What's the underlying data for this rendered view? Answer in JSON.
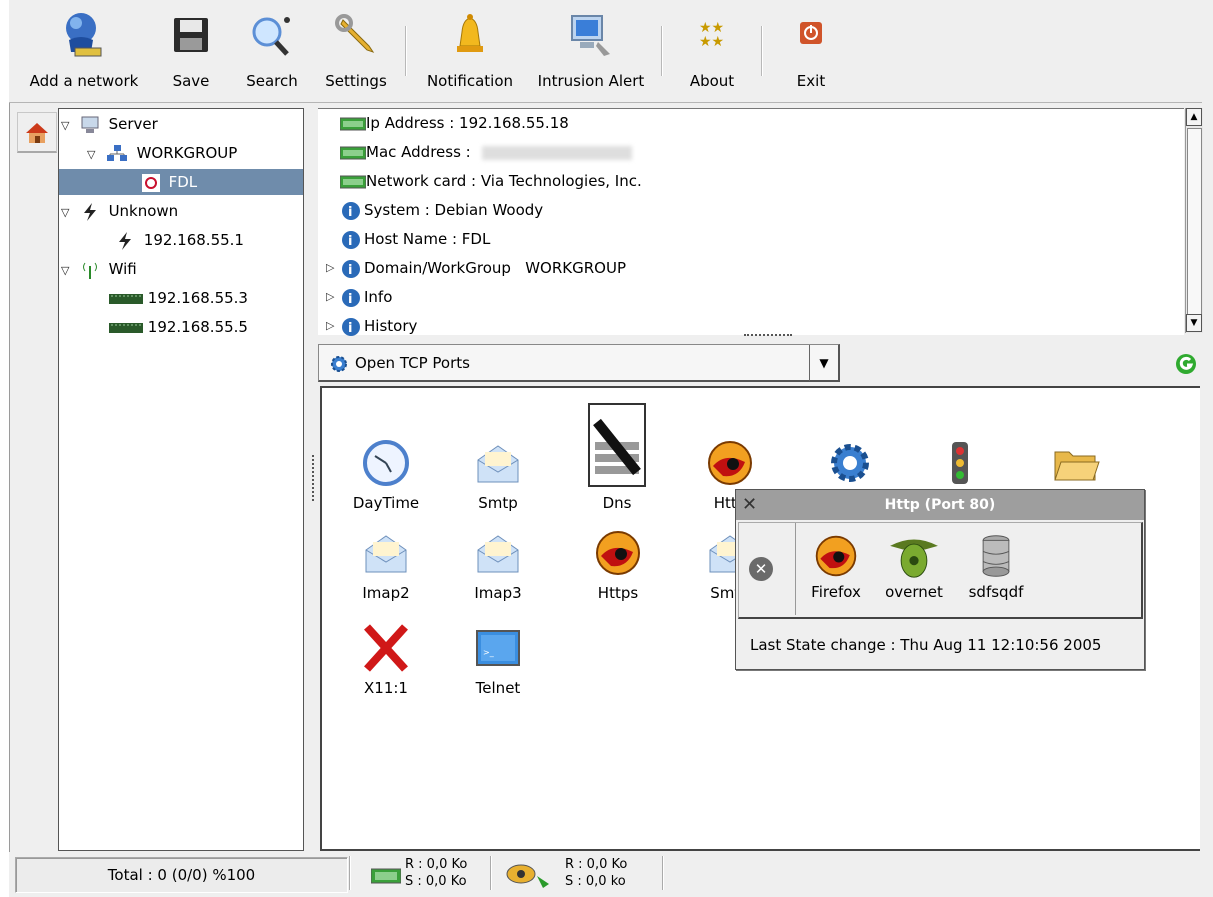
{
  "toolbar": {
    "items": [
      {
        "label": "Add a network",
        "icon": "network-globe-icon"
      },
      {
        "label": "Save",
        "icon": "floppy-disk-icon"
      },
      {
        "label": "Search",
        "icon": "magnifier-icon"
      },
      {
        "label": "Settings",
        "icon": "wrench-icon"
      },
      {
        "label": "Notification",
        "icon": "bell-icon"
      },
      {
        "label": "Intrusion Alert",
        "icon": "computer-alert-icon"
      },
      {
        "label": "About",
        "icon": "stars-icon"
      },
      {
        "label": "Exit",
        "icon": "power-icon"
      }
    ]
  },
  "tree": {
    "server": "Server",
    "workgroup": "WORKGROUP",
    "fdl": "FDL",
    "unknown": "Unknown",
    "unknown_host": "192.168.55.1",
    "wifi": "Wifi",
    "wifi_host1": "192.168.55.3",
    "wifi_host2": "192.168.55.5"
  },
  "info": {
    "ip": "Ip Address : 192.168.55.18",
    "mac": "Mac Address :",
    "netcard": "Network card : Via Technologies, Inc.",
    "system": "System : Debian Woody",
    "hostname": "Host Name : FDL",
    "domain": "Domain/WorkGroup   WORKGROUP",
    "info": "Info",
    "history": "History"
  },
  "combo": {
    "selected": "Open TCP Ports"
  },
  "ports": [
    {
      "label": "DayTime",
      "icon": "clock-icon"
    },
    {
      "label": "Smtp",
      "icon": "envelope-icon"
    },
    {
      "label": "Dns",
      "icon": "dns-document-icon"
    },
    {
      "label": "Http",
      "icon": "firefox-icon"
    },
    {
      "label": "",
      "icon": "gear-icon"
    },
    {
      "label": "",
      "icon": "traffic-light-icon"
    },
    {
      "label": "",
      "icon": "folder-icon"
    },
    {
      "label": "Imap2",
      "icon": "envelope-icon"
    },
    {
      "label": "Imap3",
      "icon": "envelope-icon"
    },
    {
      "label": "Https",
      "icon": "firefox-icon"
    },
    {
      "label": "Smtp",
      "icon": "envelope-icon"
    },
    {
      "label": "X11:1",
      "icon": "red-x-icon"
    },
    {
      "label": "Telnet",
      "icon": "terminal-icon"
    }
  ],
  "popup": {
    "title": "Http (Port 80)",
    "apps": [
      "Firefox",
      "overnet",
      "sdfsqdf"
    ],
    "last_change": "Last State change : Thu Aug 11 12:10:56 2005"
  },
  "status": {
    "total": "Total : 0 (0/0) %100",
    "net_r": "R : 0,0 Ko",
    "net_s": "S : 0,0 Ko",
    "p2p_r": "R : 0,0 Ko",
    "p2p_s": "S : 0,0 ko"
  },
  "colors": {
    "selection": "#6f8cab",
    "popup_title": "#9e9e9e",
    "background": "#efefef"
  }
}
